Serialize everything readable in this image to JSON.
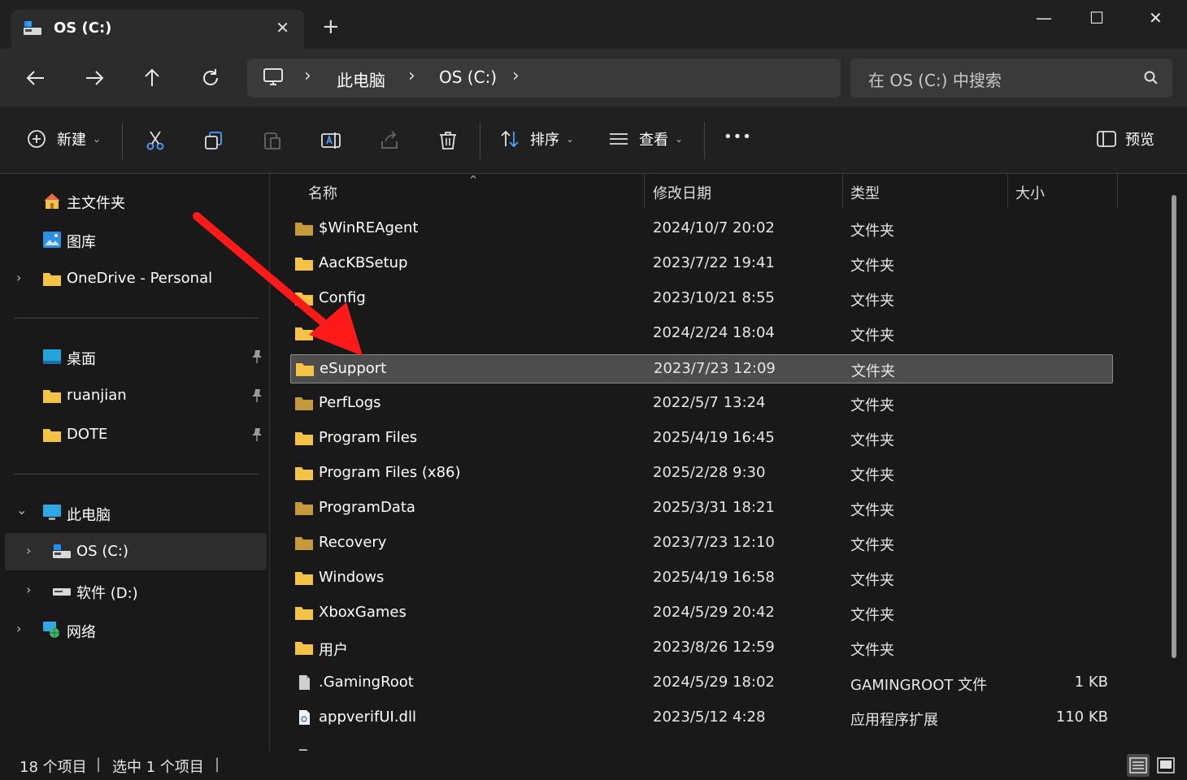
{
  "window": {
    "tab_title": "OS (C:)",
    "close_tab": "✕",
    "new_tab": "+",
    "minimize": "—",
    "maximize": "☐",
    "close": "✕"
  },
  "address": {
    "crumbs": [
      "此电脑",
      "OS (C:)"
    ],
    "search_placeholder": "在 OS (C:) 中搜索"
  },
  "toolbar": {
    "new_label": "新建",
    "sort_label": "排序",
    "view_label": "查看",
    "preview_label": "预览",
    "more_label": "•••"
  },
  "sidebar": {
    "quick": [
      {
        "label": "主文件夹",
        "icon": "home-icon"
      },
      {
        "label": "图库",
        "icon": "gallery-icon"
      },
      {
        "label": "OneDrive - Personal",
        "icon": "folder-icon"
      }
    ],
    "pinned": [
      {
        "label": "桌面",
        "icon": "desktop-icon"
      },
      {
        "label": "ruanjian",
        "icon": "folder-icon"
      },
      {
        "label": "DOTE",
        "icon": "folder-icon"
      }
    ],
    "devices": [
      {
        "label": "此电脑",
        "icon": "pc-icon"
      },
      {
        "label": "OS (C:)",
        "icon": "drive-icon"
      },
      {
        "label": "软件 (D:)",
        "icon": "drive-icon"
      },
      {
        "label": "网络",
        "icon": "network-icon"
      }
    ]
  },
  "columns": {
    "name": "名称",
    "date": "修改日期",
    "type": "类型",
    "size": "大小"
  },
  "files": [
    {
      "name": "$WinREAgent",
      "date": "2024/10/7 20:02",
      "type": "文件夹",
      "size": "",
      "kind": "folder-dim"
    },
    {
      "name": "AacKBSetup",
      "date": "2023/7/22 19:41",
      "type": "文件夹",
      "size": "",
      "kind": "folder"
    },
    {
      "name": "Config",
      "date": "2023/10/21 8:55",
      "type": "文件夹",
      "size": "",
      "kind": "folder"
    },
    {
      "name": "ESD",
      "date": "2024/2/24 18:04",
      "type": "文件夹",
      "size": "",
      "kind": "folder"
    },
    {
      "name": "eSupport",
      "date": "2023/7/23 12:09",
      "type": "文件夹",
      "size": "",
      "kind": "folder"
    },
    {
      "name": "PerfLogs",
      "date": "2022/5/7 13:24",
      "type": "文件夹",
      "size": "",
      "kind": "folder-dim"
    },
    {
      "name": "Program Files",
      "date": "2025/4/19 16:45",
      "type": "文件夹",
      "size": "",
      "kind": "folder"
    },
    {
      "name": "Program Files (x86)",
      "date": "2025/2/28 9:30",
      "type": "文件夹",
      "size": "",
      "kind": "folder"
    },
    {
      "name": "ProgramData",
      "date": "2025/3/31 18:21",
      "type": "文件夹",
      "size": "",
      "kind": "folder-dim"
    },
    {
      "name": "Recovery",
      "date": "2023/7/23 12:10",
      "type": "文件夹",
      "size": "",
      "kind": "folder-dim"
    },
    {
      "name": "Windows",
      "date": "2025/4/19 16:58",
      "type": "文件夹",
      "size": "",
      "kind": "folder"
    },
    {
      "name": "XboxGames",
      "date": "2024/5/29 20:42",
      "type": "文件夹",
      "size": "",
      "kind": "folder"
    },
    {
      "name": "用户",
      "date": "2023/8/26 12:59",
      "type": "文件夹",
      "size": "",
      "kind": "folder"
    },
    {
      "name": ".GamingRoot",
      "date": "2024/5/29 18:02",
      "type": "GAMINGROOT 文件",
      "size": "1 KB",
      "kind": "file"
    },
    {
      "name": "appverifUI.dll",
      "date": "2023/5/12 4:28",
      "type": "应用程序扩展",
      "size": "110 KB",
      "kind": "dll"
    }
  ],
  "selected_index": 4,
  "status": {
    "count": "18 个项目",
    "selected": "选中 1 个项目"
  },
  "colors": {
    "accent_folder": "#f4c244",
    "folder_dim": "#c49a3a",
    "arrow": "#ff1a1a"
  }
}
